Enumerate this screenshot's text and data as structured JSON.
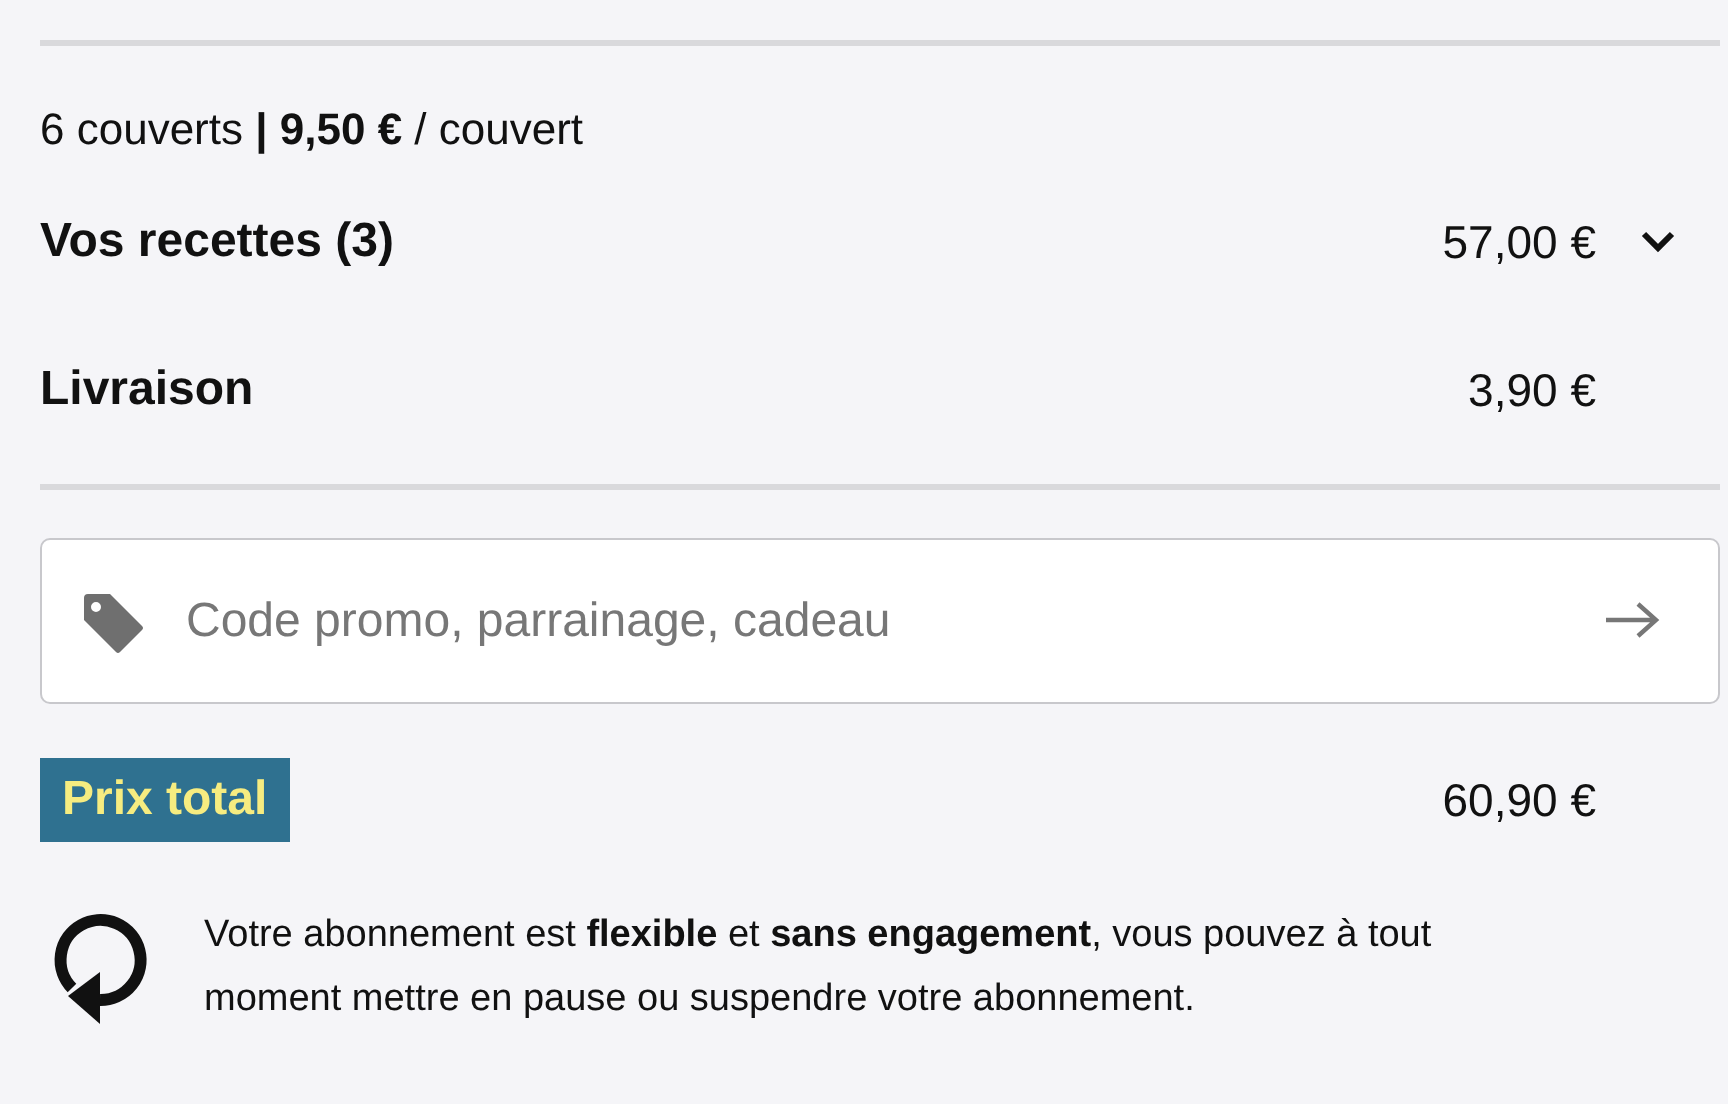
{
  "summary": "6 couverts **|** **9,50 €** / couvert",
  "lines": [
    {
      "kind": "expandable",
      "label": "Vos recettes (3)",
      "amount": "57,00 €",
      "expanded": false
    },
    {
      "kind": "plain",
      "label": "Livraison",
      "amount": "3,90 €"
    }
  ],
  "promo": {
    "placeholder": "Code promo, parrainage, cadeau"
  },
  "total": {
    "label": "Prix total",
    "amount": "60,90 €"
  },
  "note": "Votre abonnement est **flexible** et **sans engagement**, vous pouvez à tout moment mettre en pause ou suspendre votre abonnement."
}
